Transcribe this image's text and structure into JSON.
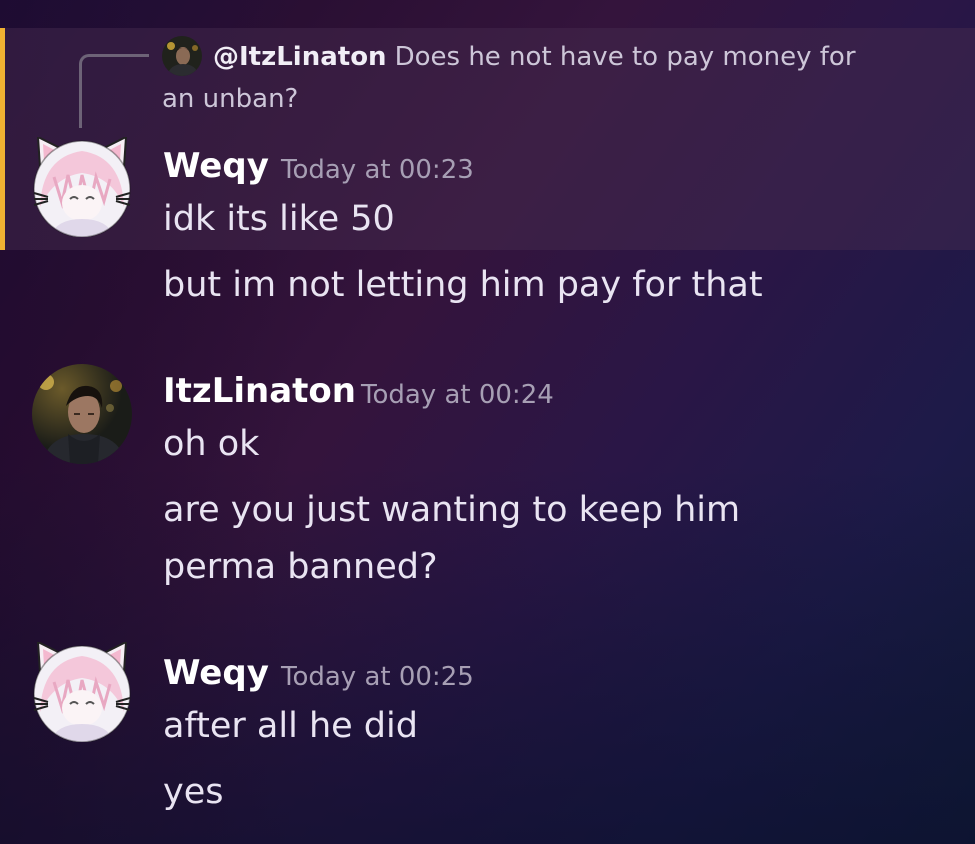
{
  "reply": {
    "author": "@ItzLinaton",
    "text": "Does he not have to pay money for an unban?"
  },
  "messages": [
    {
      "author": "Weqy",
      "timestamp": "Today at 00:23",
      "avatar": "anime-cat-ears-avatar",
      "lines": [
        "idk its like 50",
        "but im not letting him pay for that"
      ]
    },
    {
      "author": "ItzLinaton",
      "timestamp": "Today at 00:24",
      "avatar": "photo-portrait-avatar",
      "lines": [
        "oh ok",
        "are you just wanting to keep him perma banned?"
      ]
    },
    {
      "author": "Weqy",
      "timestamp": "Today at 00:25",
      "avatar": "anime-cat-ears-avatar",
      "lines": [
        "after all he did",
        "yes"
      ]
    }
  ],
  "colors": {
    "reply_bar": "#f0b132",
    "username": "#ffffff",
    "timestamp": "#a79fb4",
    "message_text": "#e9e4f2"
  }
}
